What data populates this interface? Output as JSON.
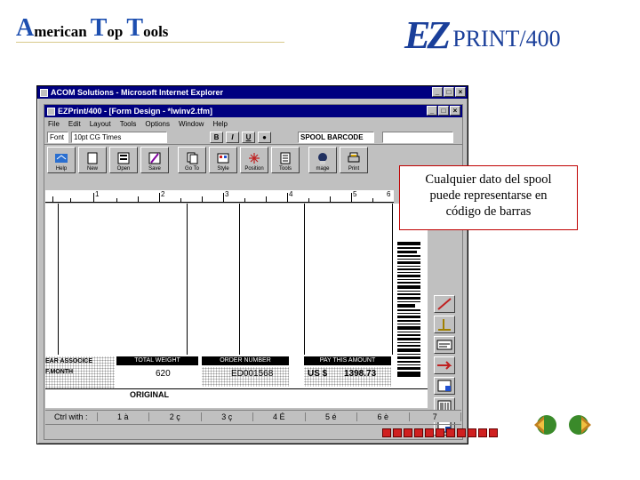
{
  "brand": {
    "part1_initial": "A",
    "part1_rest": "merican",
    "part2_initial": "T",
    "part2_rest": "op",
    "part3_initial": "T",
    "part3_rest": "ools"
  },
  "product_logo": {
    "mark": "EZ",
    "name": "PRINT/400"
  },
  "ie_window": {
    "title": "ACOM Solutions - Microsoft Internet Explorer"
  },
  "app_window": {
    "title": "EZPrint/400 - [Form Design - *lwinv2.tfm]",
    "menu": [
      "File",
      "Edit",
      "Layout",
      "Tools",
      "Options",
      "Window",
      "Help"
    ],
    "font_label": "Font",
    "font_value": "10pt CG Times",
    "format_buttons": [
      "B",
      "I",
      "U",
      "●"
    ],
    "object_label": "SPOOL BARCODE",
    "toolbar": [
      {
        "label": "Help",
        "icon": "help-icon"
      },
      {
        "label": "New",
        "icon": "new-icon"
      },
      {
        "label": "Open",
        "icon": "open-icon"
      },
      {
        "label": "Save",
        "icon": "save-icon"
      },
      {
        "label": "Go To",
        "icon": "goto-icon"
      },
      {
        "label": "Style",
        "icon": "style-icon"
      },
      {
        "label": "Position",
        "icon": "position-icon"
      },
      {
        "label": "Tools",
        "icon": "tools-icon"
      },
      {
        "label": "mage",
        "icon": "image-icon"
      },
      {
        "label": "Print",
        "icon": "print-icon"
      }
    ],
    "ruler_numbers": [
      "1",
      "2",
      "3",
      "4",
      "5",
      "6"
    ],
    "form": {
      "left_labels": [
        "EAR ASSOCICE",
        "F.MONTH"
      ],
      "headers": [
        "TOTAL WEIGHT",
        "ORDER NUMBER",
        "PAY THIS AMOUNT"
      ],
      "values": [
        "620",
        "ED001568",
        "US $",
        "1398.73"
      ],
      "footer": "ORIGINAL"
    },
    "fkeys": [
      "Ctrl with :",
      "1 à",
      "2 ç",
      "3 ç",
      "4 É",
      "5 é",
      "6 è",
      "7"
    ]
  },
  "callout": {
    "line1": "Cualquier dato del spool",
    "line2": "puede representarse en",
    "line3": "código de barras"
  },
  "colors": {
    "titlebar": "#000080",
    "window": "#c0c0c0",
    "callout_border": "#c00000",
    "brand_blue": "#1d4fb0"
  }
}
